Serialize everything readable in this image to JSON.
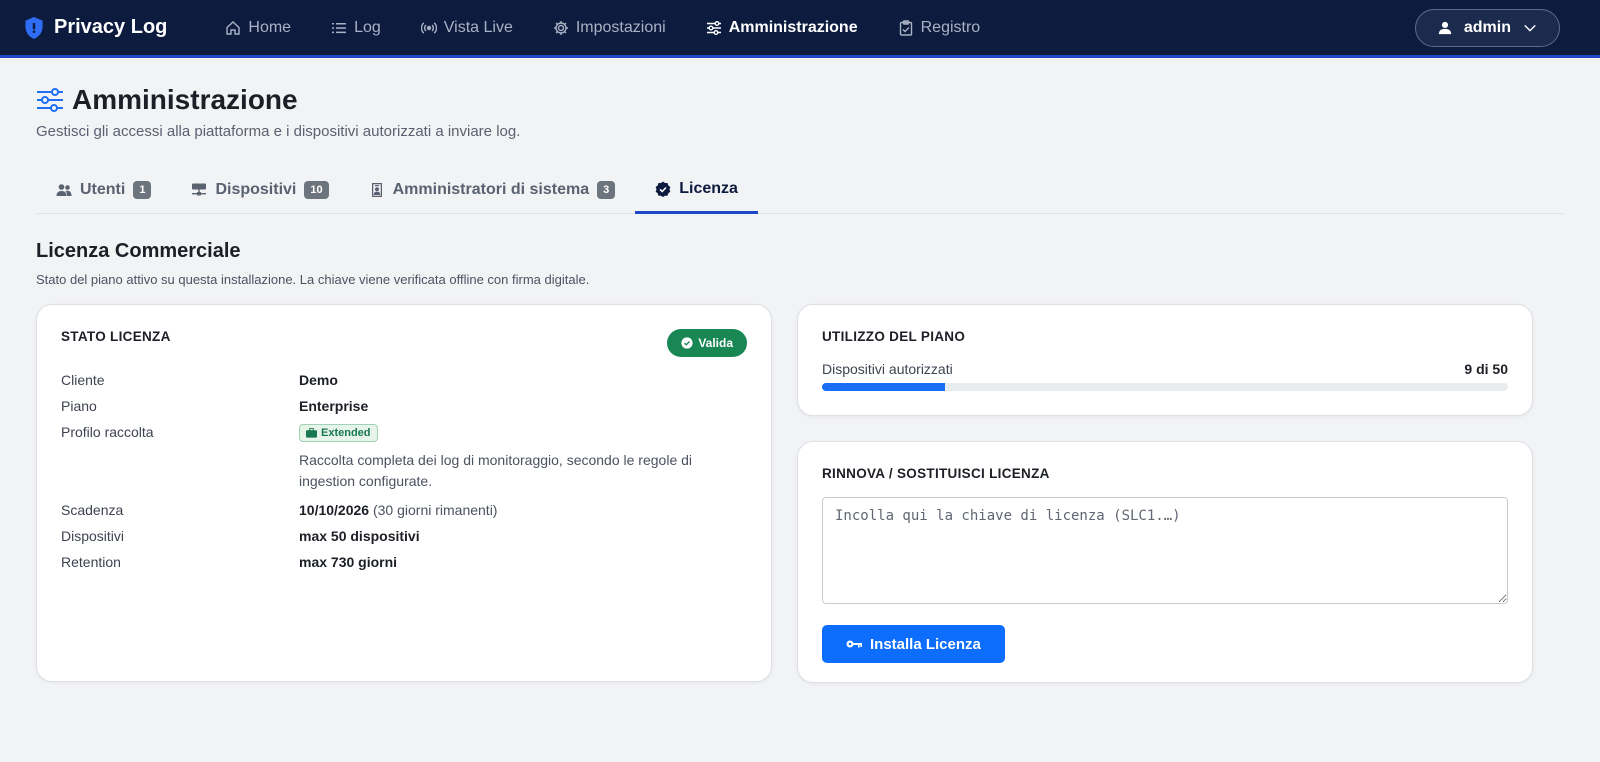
{
  "navbar": {
    "brand": "Privacy Log",
    "items": [
      {
        "label": "Home",
        "icon": "home-icon"
      },
      {
        "label": "Log",
        "icon": "list-icon"
      },
      {
        "label": "Vista Live",
        "icon": "broadcast-icon"
      },
      {
        "label": "Impostazioni",
        "icon": "gear-icon"
      },
      {
        "label": "Amministrazione",
        "icon": "sliders-icon",
        "active": true
      },
      {
        "label": "Registro",
        "icon": "clipboard-check-icon"
      }
    ],
    "user": "admin"
  },
  "page": {
    "title": "Amministrazione",
    "subtitle": "Gestisci gli accessi alla piattaforma e i dispositivi autorizzati a inviare log."
  },
  "tabs": [
    {
      "label": "Utenti",
      "count": "1",
      "icon": "people-icon"
    },
    {
      "label": "Dispositivi",
      "count": "10",
      "icon": "hdd-network-icon"
    },
    {
      "label": "Amministratori di sistema",
      "count": "3",
      "icon": "person-badge-icon"
    },
    {
      "label": "Licenza",
      "icon": "patch-check-icon",
      "active": true
    }
  ],
  "license": {
    "section_title": "Licenza Commerciale",
    "section_desc": "Stato del piano attivo su questa installazione. La chiave viene verificata offline con firma digitale.",
    "status_card": {
      "title": "STATO LICENZA",
      "status": "Valida",
      "client_label": "Cliente",
      "client_value": "Demo",
      "plan_label": "Piano",
      "plan_value": "Enterprise",
      "profile_label": "Profilo raccolta",
      "profile_badge": "Extended",
      "profile_desc": "Raccolta completa dei log di monitoraggio, secondo le regole di ingestion configurate.",
      "expiry_label": "Scadenza",
      "expiry_date": "10/10/2026",
      "expiry_remaining": "(30 giorni rimanenti)",
      "devices_label": "Dispositivi",
      "devices_value": "max 50 dispositivi",
      "retention_label": "Retention",
      "retention_value": "max 730 giorni"
    },
    "usage_card": {
      "title": "UTILIZZO DEL PIANO",
      "devices_label": "Dispositivi autorizzati",
      "devices_count": "9 di 50",
      "fraction": 0.18
    },
    "renew_card": {
      "title": "RINNOVA / SOSTITUISCI LICENZA",
      "placeholder": "Incolla qui la chiave di licenza (SLC1.…)",
      "value": "",
      "button": "Installa Licenza"
    }
  },
  "colors": {
    "navbar_bg": "#0d1b3e",
    "accent": "#1f48c9",
    "primary_button": "#0d6efd",
    "success": "#198754"
  }
}
